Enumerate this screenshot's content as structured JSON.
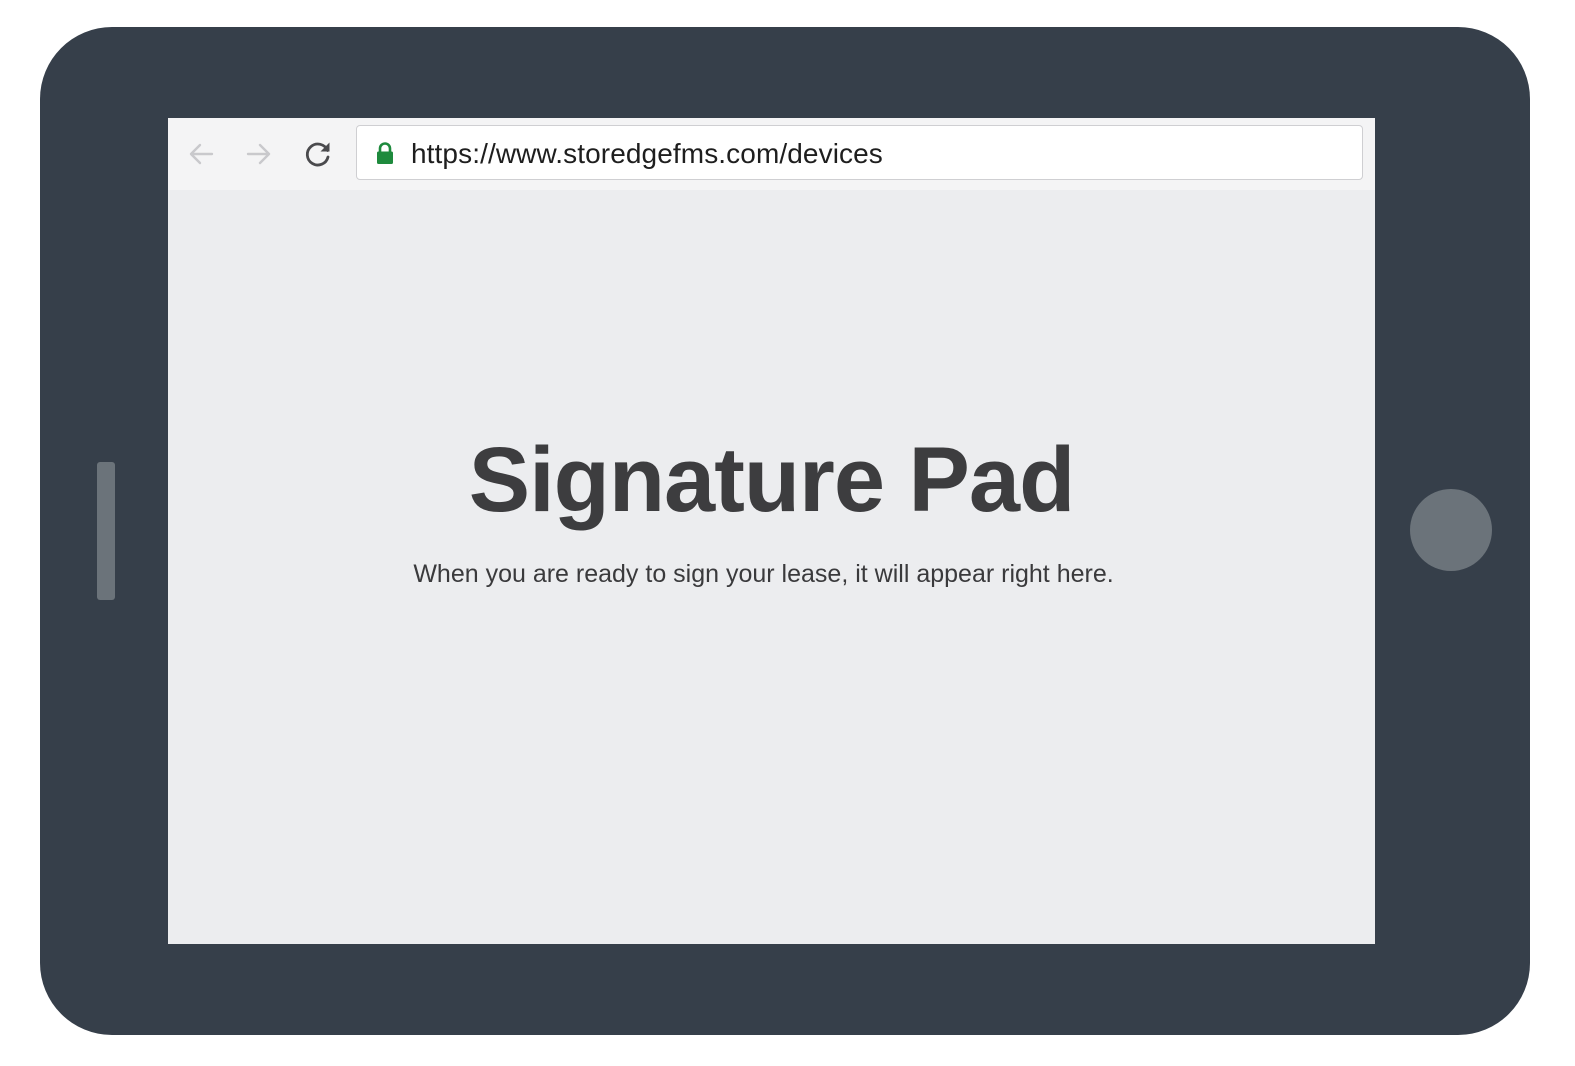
{
  "device": {
    "frame_color": "#363f4a",
    "button_color": "#6b737a"
  },
  "browser": {
    "back_icon": "arrow-left-icon",
    "forward_icon": "arrow-right-icon",
    "reload_icon": "reload-icon",
    "lock_icon": "lock-icon",
    "lock_color": "#1e8a3d",
    "url": "https://www.storedgefms.com/devices"
  },
  "page": {
    "title": "Signature Pad",
    "message": "When you are ready to sign your lease, it will appear right here."
  }
}
